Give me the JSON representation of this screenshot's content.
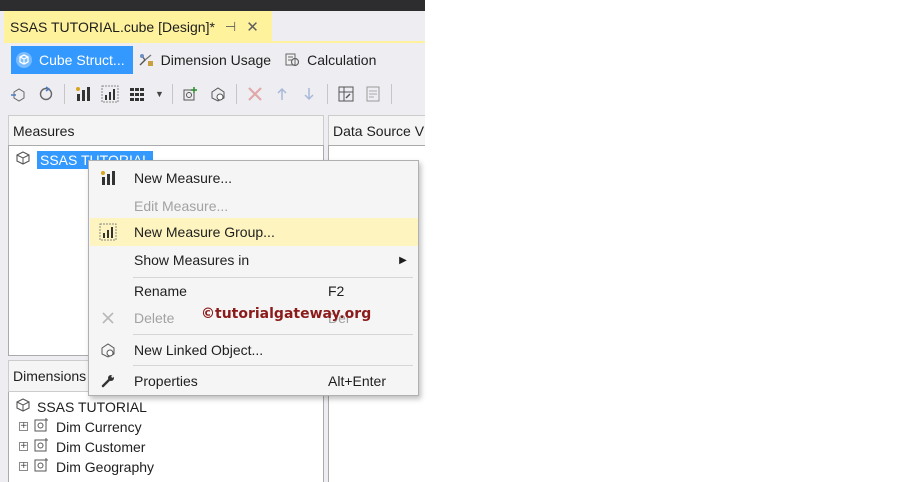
{
  "document_tab": {
    "title": "SSAS TUTORIAL.cube [Design]*",
    "pin_glyph": "⊣",
    "close_glyph": "✕"
  },
  "designer_tabs": [
    {
      "label": "Cube Struct...",
      "icon": "cube-structure-icon"
    },
    {
      "label": "Dimension Usage",
      "icon": "dimension-usage-icon"
    },
    {
      "label": "Calculation",
      "icon": "calculations-icon"
    }
  ],
  "panes": {
    "measures": {
      "title": "Measures",
      "root": "SSAS TUTORIAL"
    },
    "data_source_view": {
      "title": "Data Source V"
    },
    "dimensions": {
      "title": "Dimensions",
      "root": "SSAS TUTORIAL",
      "items": [
        "Dim Currency",
        "Dim Customer",
        "Dim Geography"
      ]
    }
  },
  "context_menu": {
    "items": [
      {
        "label": "New Measure...",
        "icon": "new-measure-icon",
        "enabled": true
      },
      {
        "label": "Edit Measure...",
        "icon": "",
        "enabled": false
      },
      {
        "label": "New Measure Group...",
        "icon": "new-measure-group-icon",
        "enabled": true,
        "highlighted": true
      },
      {
        "label": "Show Measures in",
        "icon": "",
        "enabled": true,
        "submenu_glyph": "▶"
      },
      {
        "label": "Rename",
        "shortcut": "F2",
        "enabled": true
      },
      {
        "label": "Delete",
        "shortcut": "Del",
        "icon": "delete-icon",
        "enabled": false
      },
      {
        "label": "New Linked Object...",
        "icon": "linked-object-icon",
        "enabled": true
      },
      {
        "label": "Properties",
        "shortcut": "Alt+Enter",
        "icon": "wrench-icon",
        "enabled": true
      }
    ]
  },
  "watermark": "©tutorialgateway.org",
  "colors": {
    "tab_highlight": "#fff29d",
    "selection_blue": "#3399ff",
    "menu_hover": "#fdf4bf",
    "watermark": "#8b1a1a"
  }
}
